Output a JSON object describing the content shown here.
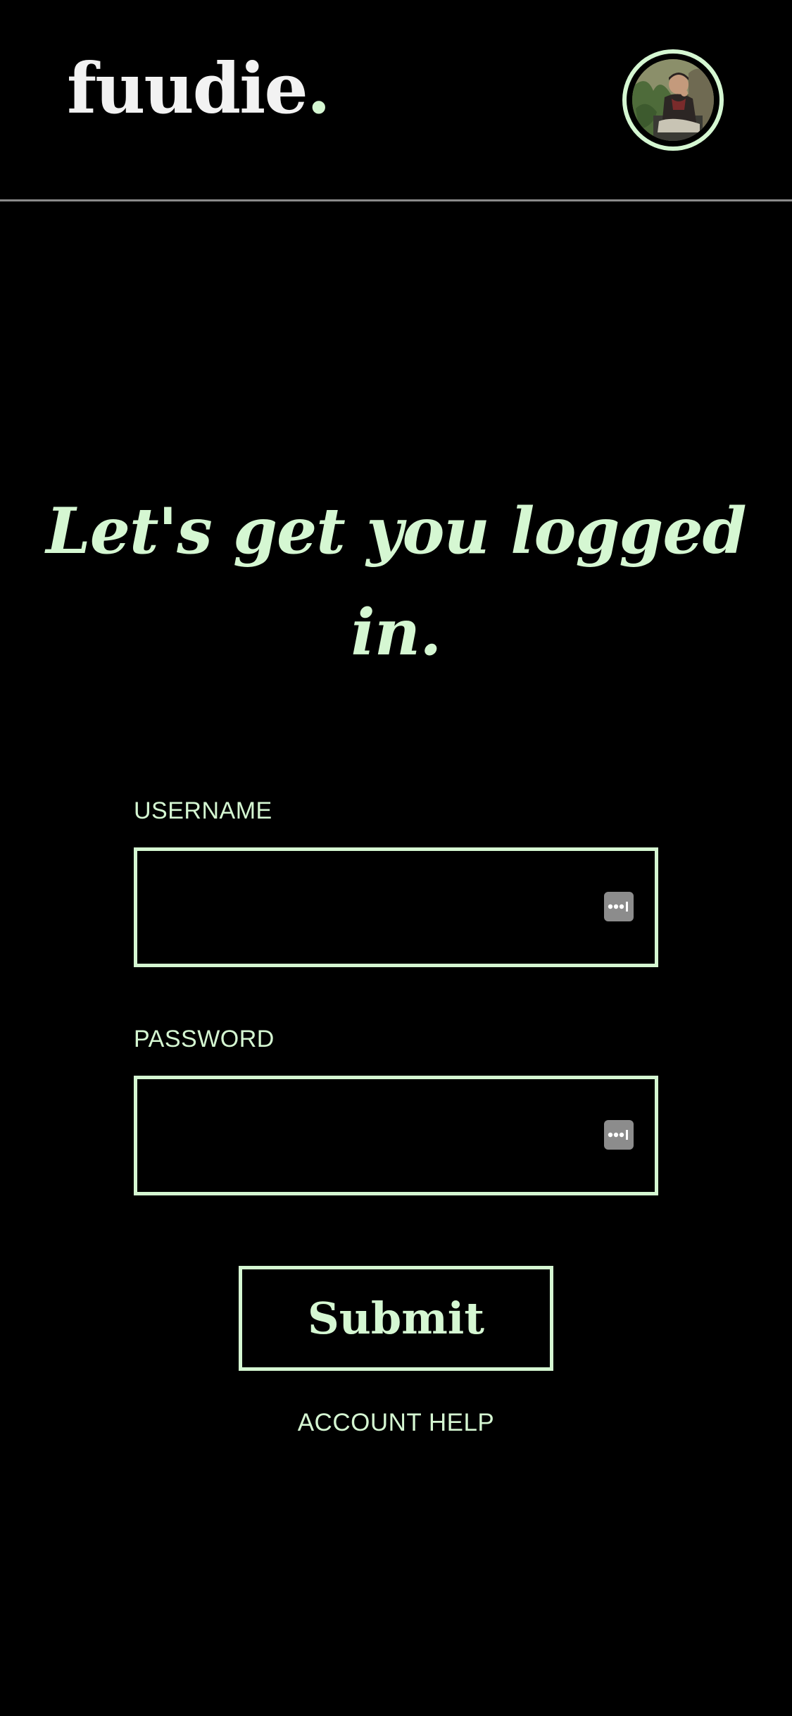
{
  "header": {
    "logo_text": "fuudie",
    "logo_dot": ".",
    "avatar_alt": "user avatar"
  },
  "main": {
    "headline_line1": "Let's get you logged",
    "headline_line2": "in.",
    "username": {
      "label": "USERNAME",
      "value": "",
      "placeholder": ""
    },
    "password": {
      "label": "PASSWORD",
      "value": "",
      "placeholder": ""
    },
    "submit_label": "Submit",
    "account_help": "ACCOUNT HELP"
  },
  "colors": {
    "background": "#000000",
    "accent": "#d5f7d2",
    "logo": "#f2f2f2",
    "divider": "#8a8a8a",
    "autofill_icon": "#8c8c8c"
  }
}
